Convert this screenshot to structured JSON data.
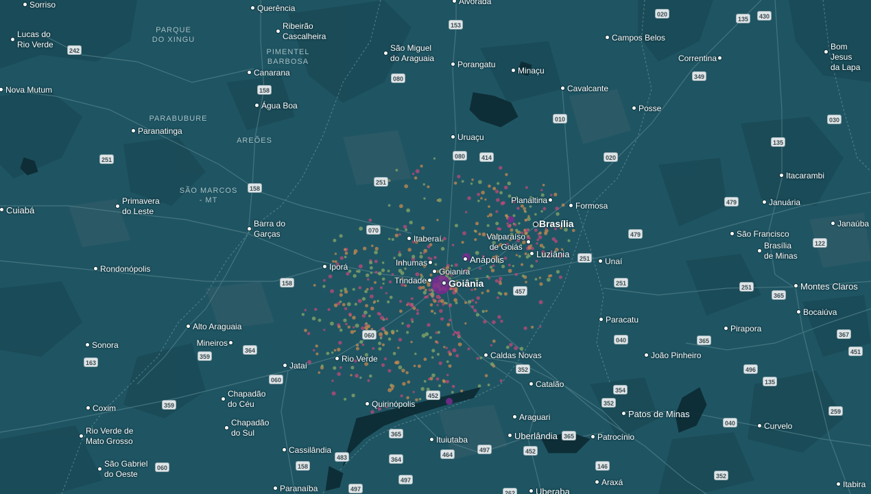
{
  "colors": {
    "background": "#1f5563",
    "forest": "#1a4a56",
    "shrub": "#2e5a66",
    "river": "#0e2c35",
    "road": "#4f7d88",
    "label": "#ffffff",
    "area_label": "#a8c2c8",
    "dot_pink": "#c2487a",
    "dot_orange": "#c98a4d",
    "dot_green": "#8aa866",
    "dot_purple": "#7a2a8f"
  },
  "icons": {
    "place": "place-dot-icon",
    "capital": "capital-ring-icon",
    "road": "road-shield-icon"
  },
  "places": [
    {
      "label": "Sorriso",
      "style": "minor"
    },
    {
      "label": "Querência",
      "style": "minor"
    },
    {
      "label": "Alvorada",
      "style": "minor"
    },
    {
      "label": "Lucas do\nRio Verde",
      "style": "minor"
    },
    {
      "label": "Ribeirão\nCascalheira",
      "style": "minor"
    },
    {
      "label": "São Miguel\ndo Araguaia",
      "style": "minor"
    },
    {
      "label": "Campos Belos",
      "style": "minor"
    },
    {
      "label": "Correntina",
      "style": "minor"
    },
    {
      "label": "Bom Jesus\nda Lapa",
      "style": "minor"
    },
    {
      "label": "Porangatu",
      "style": "minor"
    },
    {
      "label": "Minaçu",
      "style": "minor"
    },
    {
      "label": "Canarana",
      "style": "minor"
    },
    {
      "label": "Nova Mutum",
      "style": "minor"
    },
    {
      "label": "Cavalcante",
      "style": "minor"
    },
    {
      "label": "Água Boa",
      "style": "minor"
    },
    {
      "label": "Posse",
      "style": "minor"
    },
    {
      "label": "Paranatinga",
      "style": "minor"
    },
    {
      "label": "Uruaçu",
      "style": "minor"
    },
    {
      "label": "Itacarambi",
      "style": "minor"
    },
    {
      "label": "Planaltina",
      "style": "minor"
    },
    {
      "label": "Formosa",
      "style": "minor"
    },
    {
      "label": "Januária",
      "style": "minor"
    },
    {
      "label": "Cuiabá",
      "style": "bold-city"
    },
    {
      "label": "Primavera\ndo Leste",
      "style": "minor"
    },
    {
      "label": "Brasília",
      "style": "capital"
    },
    {
      "label": "Janaúba",
      "style": "minor"
    },
    {
      "label": "Barra do\nGarças",
      "style": "minor"
    },
    {
      "label": "São Francisco",
      "style": "minor"
    },
    {
      "label": "Itaberaí",
      "style": "minor"
    },
    {
      "label": "Valparaíso\nde Goiás",
      "style": "minor"
    },
    {
      "label": "Brasília\nde Minas",
      "style": "minor"
    },
    {
      "label": "Luziânia",
      "style": "major"
    },
    {
      "label": "Anápolis",
      "style": "major"
    },
    {
      "label": "Inhumas",
      "style": "minor"
    },
    {
      "label": "Unaí",
      "style": "minor"
    },
    {
      "label": "Rondonópolis",
      "style": "minor"
    },
    {
      "label": "Iporá",
      "style": "minor"
    },
    {
      "label": "Goianira",
      "style": "minor"
    },
    {
      "label": "Trindade",
      "style": "minor"
    },
    {
      "label": "Goiânia",
      "style": "major-big"
    },
    {
      "label": "Montes Claros",
      "style": "major"
    },
    {
      "label": "Bocaiúva",
      "style": "minor"
    },
    {
      "label": "Paracatu",
      "style": "minor"
    },
    {
      "label": "Alto Araguaia",
      "style": "minor"
    },
    {
      "label": "Pirapora",
      "style": "minor"
    },
    {
      "label": "Sonora",
      "style": "minor"
    },
    {
      "label": "Mineiros",
      "style": "minor"
    },
    {
      "label": "Caldas Novas",
      "style": "minor"
    },
    {
      "label": "João Pinheiro",
      "style": "minor"
    },
    {
      "label": "Rio Verde",
      "style": "minor"
    },
    {
      "label": "Jataí",
      "style": "minor"
    },
    {
      "label": "Catalão",
      "style": "minor"
    },
    {
      "label": "Chapadão\ndo Céu",
      "style": "minor"
    },
    {
      "label": "Quirinópolis",
      "style": "minor"
    },
    {
      "label": "Coxim",
      "style": "minor"
    },
    {
      "label": "Patos de Minas",
      "style": "major"
    },
    {
      "label": "Araguari",
      "style": "minor"
    },
    {
      "label": "Curvelo",
      "style": "minor"
    },
    {
      "label": "Chapadão\ndo Sul",
      "style": "minor"
    },
    {
      "label": "Rio Verde de\nMato Grosso",
      "style": "minor"
    },
    {
      "label": "Ituiutaba",
      "style": "minor"
    },
    {
      "label": "Uberlândia",
      "style": "major"
    },
    {
      "label": "Patrocínio",
      "style": "minor"
    },
    {
      "label": "Cassilândia",
      "style": "minor"
    },
    {
      "label": "São Gabriel\ndo Oeste",
      "style": "minor"
    },
    {
      "label": "Araxá",
      "style": "minor"
    },
    {
      "label": "Paranaíba",
      "style": "minor"
    },
    {
      "label": "Uberaba",
      "style": "major"
    },
    {
      "label": "Itabira",
      "style": "minor"
    }
  ],
  "areas": [
    {
      "label": "PARQUE\nDO XINGU"
    },
    {
      "label": "PIMENTEL\nBARBOSA"
    },
    {
      "label": "PARABUBURE"
    },
    {
      "label": "AREÕES"
    },
    {
      "label": "SÃO MARCOS\n- MT"
    }
  ],
  "roads": [
    "020",
    "135",
    "430",
    "153",
    "242",
    "080",
    "349",
    "158",
    "010",
    "030",
    "135",
    "251",
    "080",
    "414",
    "020",
    "251",
    "158",
    "479",
    "070",
    "479",
    "122",
    "251",
    "158",
    "457",
    "251",
    "251",
    "365",
    "040",
    "367",
    "060",
    "364",
    "359",
    "365",
    "451",
    "496",
    "060",
    "352",
    "135",
    "452",
    "354",
    "163",
    "359",
    "352",
    "040",
    "259",
    "365",
    "483",
    "364",
    "464",
    "497",
    "452",
    "146",
    "158",
    "060",
    "497",
    "497",
    "262",
    "352",
    "365"
  ]
}
